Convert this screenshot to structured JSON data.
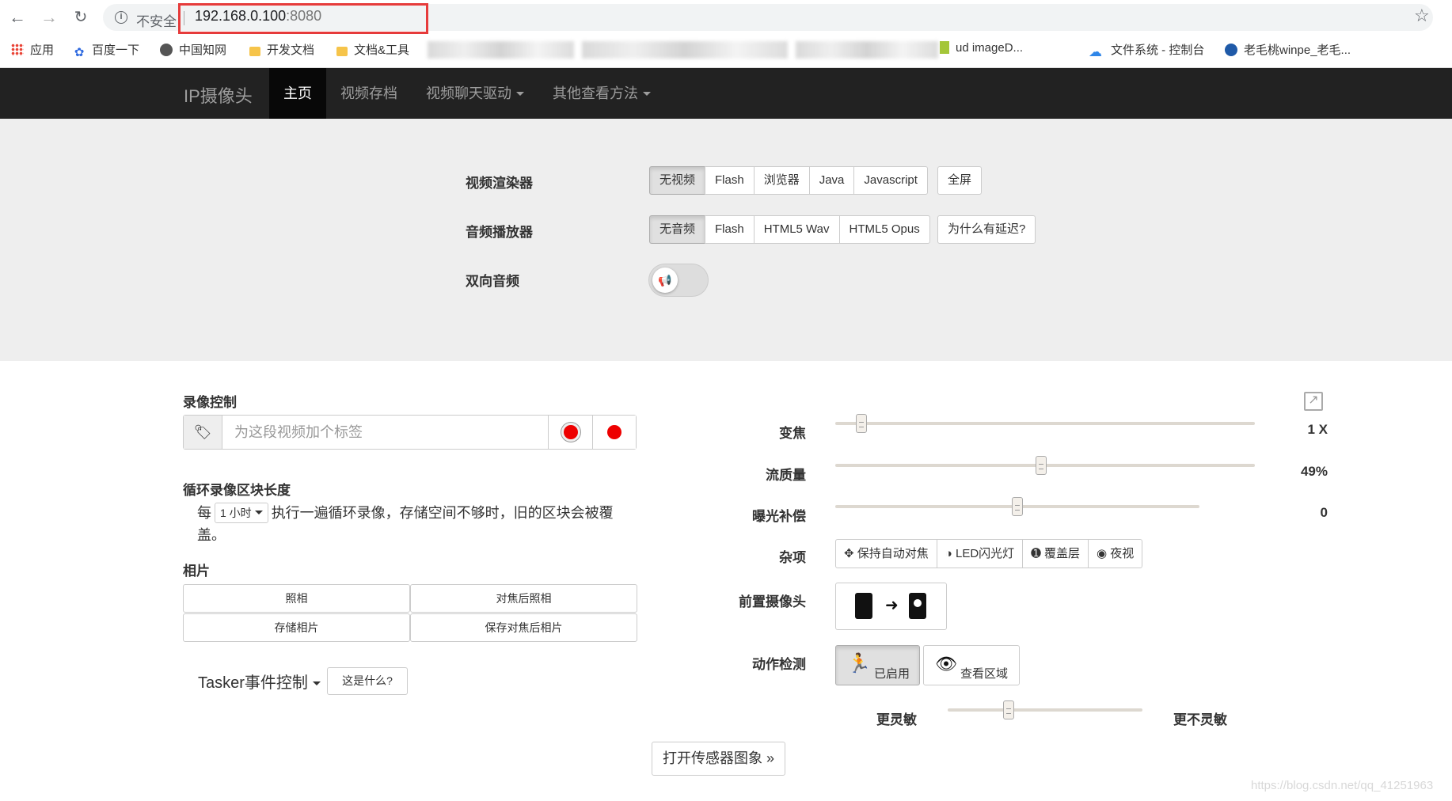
{
  "browser": {
    "security_label": "不安全",
    "url_host": "192.168.0.100",
    "url_port": ":8080",
    "bookmarks": [
      {
        "label": "应用",
        "icon": "apps-grid-icon"
      },
      {
        "label": "百度一下",
        "icon": "baidu-paw-icon"
      },
      {
        "label": "中国知网",
        "icon": "globe-icon"
      },
      {
        "label": "开发文档",
        "icon": "folder-icon"
      },
      {
        "label": "文档&工具",
        "icon": "folder-icon"
      },
      {
        "label": "ud imageD...",
        "icon": "green-square-icon"
      },
      {
        "label": "文件系统 - 控制台",
        "icon": "cloud-icon"
      },
      {
        "label": "老毛桃winpe_老毛...",
        "icon": "peach-icon"
      }
    ]
  },
  "navbar": {
    "brand": "IP摄像头",
    "items": [
      {
        "label": "主页",
        "active": true
      },
      {
        "label": "视频存档"
      },
      {
        "label": "视频聊天驱动",
        "dropdown": true
      },
      {
        "label": "其他查看方法",
        "dropdown": true
      }
    ]
  },
  "settings": {
    "video_renderer": {
      "label": "视频渲染器",
      "options": [
        "无视频",
        "Flash",
        "浏览器",
        "Java",
        "Javascript"
      ],
      "selected": "无视频",
      "fullscreen": "全屏"
    },
    "audio_player": {
      "label": "音频播放器",
      "options": [
        "无音频",
        "Flash",
        "HTML5 Wav",
        "HTML5 Opus"
      ],
      "selected": "无音频",
      "why_delay": "为什么有延迟?"
    },
    "two_way_audio": {
      "label": "双向音频",
      "enabled": false
    }
  },
  "left": {
    "recording": {
      "title": "录像控制",
      "placeholder": "为这段视频加个标签"
    },
    "loop": {
      "title": "循环录像区块长度",
      "prefix": "每",
      "select": "1 小时",
      "text": "执行一遍循环录像，存储空间不够时，旧的区块会被覆盖。"
    },
    "photos": {
      "title": "相片",
      "buttons": [
        "照相",
        "对焦后照相",
        "存储相片",
        "保存对焦后相片"
      ]
    },
    "tasker": {
      "label": "Tasker事件控制",
      "whats_this": "这是什么?"
    }
  },
  "right": {
    "zoom": {
      "label": "变焦",
      "value_text": "1 X",
      "level": 0.05
    },
    "quality": {
      "label": "流质量",
      "value_text": "49%",
      "level": 0.49
    },
    "exposure": {
      "label": "曝光补偿",
      "value_text": "0",
      "level": 0.5
    },
    "misc": {
      "label": "杂项",
      "buttons": [
        {
          "label": "保持自动对焦",
          "icon": "crosshair-icon"
        },
        {
          "label": "LED闪光灯",
          "icon": "contrast-icon"
        },
        {
          "label": "覆盖层",
          "icon": "info-icon"
        },
        {
          "label": "夜视",
          "icon": "eye-icon"
        }
      ]
    },
    "front_camera": {
      "label": "前置摄像头"
    },
    "motion": {
      "label": "动作检测",
      "enabled_label": "已启用",
      "view_area_label": "查看区域"
    },
    "sensitivity": {
      "more": "更灵敏",
      "less": "更不灵敏",
      "level": 0.3
    },
    "sensor_button": "打开传感器图象 »"
  },
  "watermark": "https://blog.csdn.net/qq_41251963",
  "colors": {
    "navbar_bg": "#222222",
    "settings_bg": "#eeeeee",
    "url_highlight": "#e63b3b",
    "record_red": "#ee0000"
  }
}
